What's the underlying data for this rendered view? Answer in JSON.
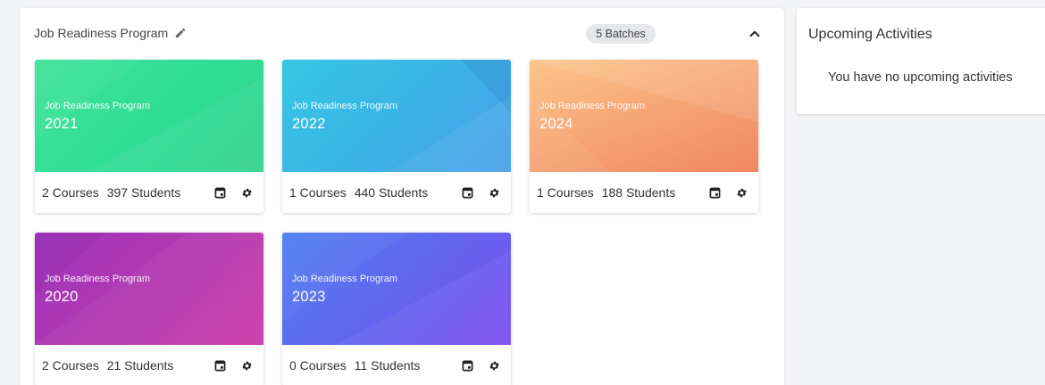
{
  "program": {
    "title": "Job Readiness Program",
    "batch_count_label": "5 Batches",
    "batches": [
      {
        "program_label": "Job Readiness Program",
        "year": "2021",
        "courses": "2 Courses",
        "students": "397 Students",
        "color": "#35d18f"
      },
      {
        "program_label": "Job Readiness Program",
        "year": "2022",
        "courses": "1 Courses",
        "students": "440 Students",
        "color": "#3ab4e6"
      },
      {
        "program_label": "Job Readiness Program",
        "year": "2024",
        "courses": "1 Courses",
        "students": "188 Students",
        "color": "#f7a877"
      },
      {
        "program_label": "Job Readiness Program",
        "year": "2020",
        "courses": "2 Courses",
        "students": "21 Students",
        "color": "#b43aae"
      },
      {
        "program_label": "Job Readiness Program",
        "year": "2023",
        "courses": "0 Courses",
        "students": "11 Students",
        "color": "#6364ef"
      }
    ],
    "icons": {
      "edit": "pencil-icon",
      "collapse": "chevron-up-icon",
      "calendar": "calendar-icon",
      "settings": "gear-icon"
    }
  },
  "activities": {
    "title": "Upcoming Activities",
    "empty_message": "You have no upcoming activities"
  }
}
